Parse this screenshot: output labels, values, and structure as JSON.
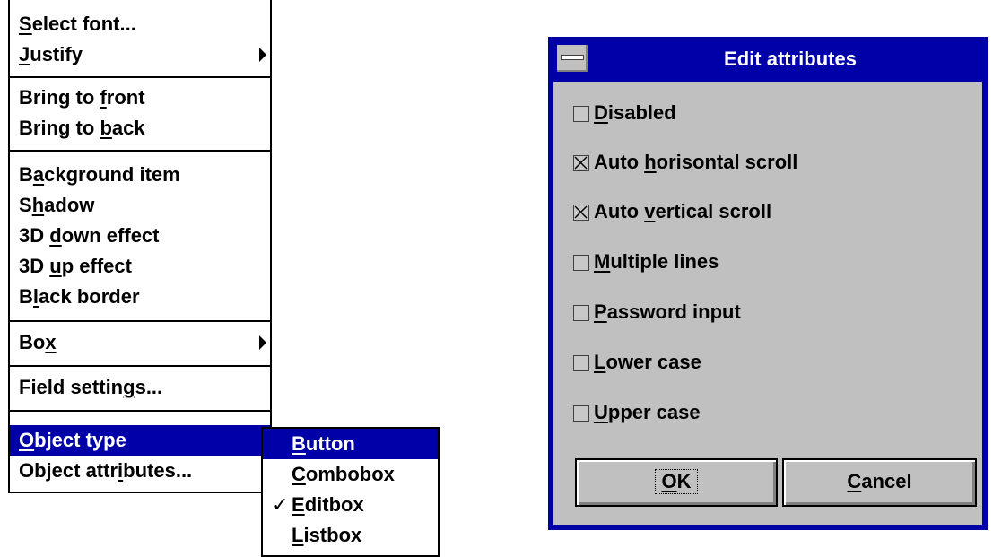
{
  "menu": {
    "items": [
      {
        "pre": "",
        "key": "S",
        "post": "elect font..."
      },
      {
        "pre": "",
        "key": "J",
        "post": "ustify"
      },
      {
        "pre": "Bring to ",
        "key": "f",
        "post": "ront"
      },
      {
        "pre": "Bring to ",
        "key": "b",
        "post": "ack"
      },
      {
        "pre": "B",
        "key": "a",
        "post": "ckground item"
      },
      {
        "pre": "S",
        "key": "h",
        "post": "adow"
      },
      {
        "pre": "3D ",
        "key": "d",
        "post": "own effect"
      },
      {
        "pre": "3D ",
        "key": "u",
        "post": "p effect"
      },
      {
        "pre": "B",
        "key": "l",
        "post": "ack border"
      },
      {
        "pre": "Bo",
        "key": "x",
        "post": ""
      },
      {
        "pre": "Field settin",
        "key": "g",
        "post": "s..."
      },
      {
        "pre": "",
        "key": "O",
        "post": "bject type"
      },
      {
        "pre": "Object attr",
        "key": "i",
        "post": "butes..."
      }
    ]
  },
  "submenu": {
    "items": [
      {
        "key": "B",
        "post": "utton",
        "checked": false
      },
      {
        "key": "C",
        "post": "ombobox",
        "checked": false
      },
      {
        "key": "E",
        "post": "ditbox",
        "checked": true
      },
      {
        "key": "L",
        "post": "istbox",
        "checked": false
      }
    ],
    "check_mark": "✓"
  },
  "dialog": {
    "title": "Edit attributes",
    "options": [
      {
        "pre": "",
        "key": "D",
        "post": "isabled",
        "checked": false
      },
      {
        "pre": "Auto ",
        "key": "h",
        "post": "orisontal scroll",
        "checked": true
      },
      {
        "pre": "Auto ",
        "key": "v",
        "post": "ertical scroll",
        "checked": true
      },
      {
        "pre": "",
        "key": "M",
        "post": "ultiple lines",
        "checked": false
      },
      {
        "pre": "",
        "key": "P",
        "post": "assword input",
        "checked": false
      },
      {
        "pre": "",
        "key": "L",
        "post": "ower case",
        "checked": false
      },
      {
        "pre": "",
        "key": "U",
        "post": "pper case",
        "checked": false
      }
    ],
    "ok": {
      "key": "O",
      "post": "K"
    },
    "cancel": {
      "key": "C",
      "post": "ancel"
    }
  },
  "colors": {
    "highlight": "#0000a8",
    "face": "#c0c0c0"
  },
  "icons": {
    "submenu_arrow": "right-triangle-icon",
    "system_menu": "system-menu-icon",
    "checkbox_cross": "x-mark-icon"
  }
}
